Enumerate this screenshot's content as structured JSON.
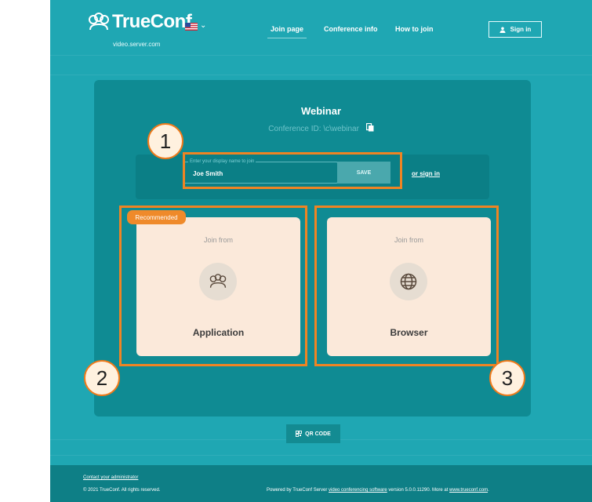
{
  "header": {
    "logo_text": "TrueConf",
    "server": "video.server.com",
    "nav": [
      {
        "label": "Join page",
        "active": true
      },
      {
        "label": "Conference info",
        "active": false
      },
      {
        "label": "How to join",
        "active": false
      }
    ],
    "signin_label": "Sign in"
  },
  "conference": {
    "title": "Webinar",
    "id_text": "Conference ID: \\c\\webinar"
  },
  "name_form": {
    "legend": "Enter your display name to join",
    "value": "Joe Smith",
    "save_label": "SAVE",
    "or_signin": "or sign in"
  },
  "cards": {
    "badge": "Recommended",
    "application": {
      "join_from": "Join from",
      "label": "Application",
      "icon": "trueconf-people-icon"
    },
    "browser": {
      "join_from": "Join from",
      "label": "Browser",
      "icon": "globe-icon"
    }
  },
  "annotations": [
    "1",
    "2",
    "3"
  ],
  "qr_label": "QR CODE",
  "footer": {
    "contact": "Contact your administrator",
    "copyright": "© 2021 TrueConf. All rights reserved.",
    "powered_prefix": "Powered by TrueConf Server ",
    "powered_link": "video conferencing software",
    "powered_middle": " version 5.0.0.11290. More at ",
    "powered_site": "www.trueconf.com",
    "powered_suffix": "."
  },
  "colors": {
    "background": "#1fa7b3",
    "panel": "#0f8b93",
    "card": "#fbe9da",
    "highlight": "#ef8423"
  }
}
